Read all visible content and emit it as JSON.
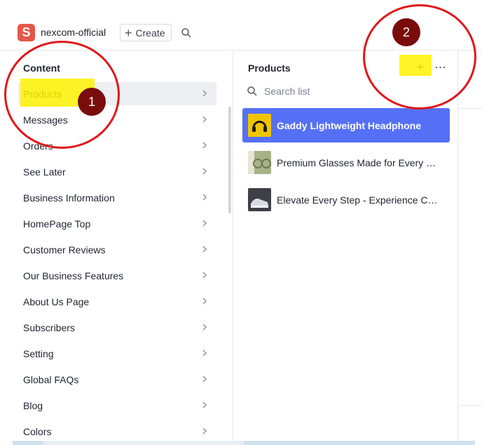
{
  "header": {
    "logo_letter": "S",
    "workspace_name": "nexcom-official",
    "create_label": "Create",
    "logo_color": "#e4574b"
  },
  "left_pane": {
    "title": "Content",
    "items": [
      {
        "label": "Products",
        "active": true
      },
      {
        "label": "Messages"
      },
      {
        "label": "Orders"
      },
      {
        "label": "See Later"
      },
      {
        "label": "Business Information"
      },
      {
        "label": "HomePage Top"
      },
      {
        "label": "Customer Reviews"
      },
      {
        "label": "Our Business Features"
      },
      {
        "label": "About Us Page"
      },
      {
        "label": "Subscribers"
      },
      {
        "label": "Setting"
      },
      {
        "label": "Global FAQs"
      },
      {
        "label": "Blog"
      },
      {
        "label": "Colors"
      }
    ]
  },
  "mid_pane": {
    "title": "Products",
    "search_placeholder": "Search list",
    "documents": [
      {
        "title": "Gaddy Lightweight Headphone",
        "selected": true,
        "thumb": "headphone-thumbnail"
      },
      {
        "title": "Premium Glasses Made for Every Vision",
        "thumb": "glasses-thumbnail"
      },
      {
        "title": "Elevate Every Step - Experience Comfort",
        "thumb": "shoes-thumbnail"
      }
    ],
    "selected_color": "#5670f5"
  },
  "annotations": {
    "badge_1": "1",
    "badge_2": "2",
    "ring_color": "#e0161b",
    "highlight_color": "#fff200"
  }
}
